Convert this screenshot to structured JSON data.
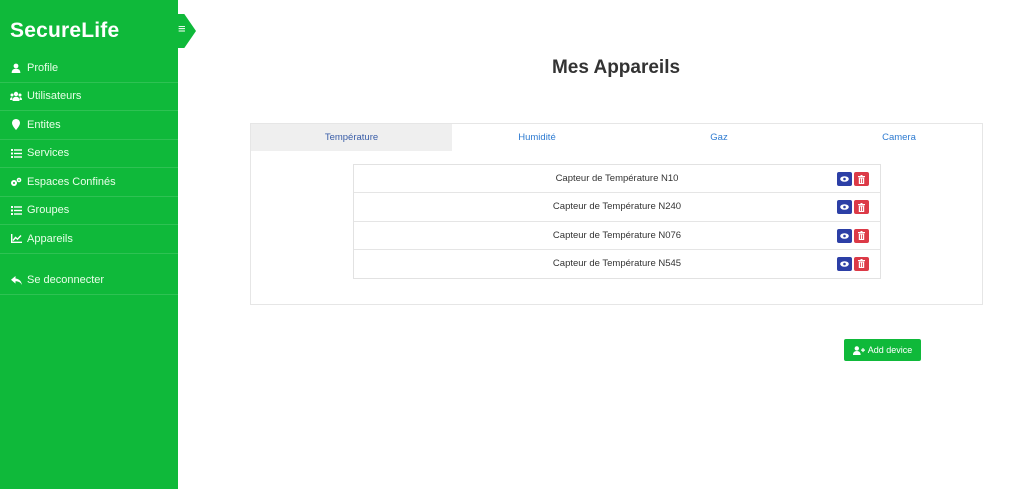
{
  "app": {
    "brand": "SecureLife",
    "toggle_glyph": "≡"
  },
  "sidebar": {
    "items": [
      {
        "label": "Profile",
        "icon": "user-icon"
      },
      {
        "label": "Utilisateurs",
        "icon": "users-icon"
      },
      {
        "label": "Entites",
        "icon": "map-pin-icon"
      },
      {
        "label": "Services",
        "icon": "list-icon"
      },
      {
        "label": "Espaces Confinés",
        "icon": "cogs-icon"
      },
      {
        "label": "Groupes",
        "icon": "list-icon"
      },
      {
        "label": "Appareils",
        "icon": "chart-line-icon"
      },
      {
        "label": "Se deconnecter",
        "icon": "reply-icon"
      }
    ]
  },
  "page": {
    "title": "Mes Appareils"
  },
  "tabs": [
    {
      "label": "Température",
      "active": true
    },
    {
      "label": "Humidité",
      "active": false
    },
    {
      "label": "Gaz",
      "active": false
    },
    {
      "label": "Camera",
      "active": false
    }
  ],
  "devices": [
    {
      "name": "Capteur de Température N10"
    },
    {
      "name": "Capteur de Température N240"
    },
    {
      "name": "Capteur de Température N076"
    },
    {
      "name": "Capteur de Température N545"
    }
  ],
  "actions": {
    "add_device": "Add device"
  },
  "colors": {
    "sidebar": "#0fb93a",
    "view_button": "#2c3fa6",
    "delete_button": "#dc3a47",
    "tab_link": "#2e7bd1"
  }
}
